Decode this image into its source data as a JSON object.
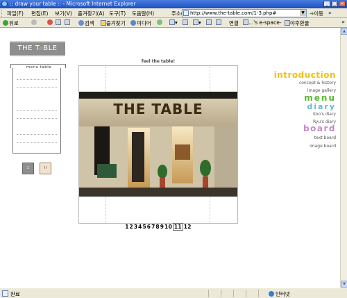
{
  "window": {
    "title": ":: draw your table :: - Microsoft Internet Explorer",
    "buttons": {
      "minimize": "_",
      "maximize": "□",
      "close": "×"
    }
  },
  "menubar": {
    "items": [
      "파일(F)",
      "편집(E)",
      "보기(V)",
      "즐겨찾기(A)",
      "도구(T)",
      "도움말(H)"
    ],
    "address_label": "주소(D)",
    "address_value": "http://www.the-table.com/1-3.php#",
    "go_label": "이동",
    "links_label": "»"
  },
  "toolbar": {
    "back": "뒤로",
    "forward": "→",
    "search": "검색",
    "favorites": "즐겨찾기",
    "media": "미디어",
    "links_label": "연결",
    "link1": "...'s e-space-",
    "link2": "야후환율",
    "more": "»"
  },
  "site": {
    "logo": {
      "pre": "THE T",
      "accent": "a",
      "post": "BLE"
    },
    "nav_header": "menu table",
    "nav": {
      "introduction": "introduction",
      "concept": "concept & history",
      "gallery": "image gallery",
      "menu": "menu",
      "diary": "diary",
      "koo": "Koo's diary",
      "ryu": "Ryu's diary",
      "board": "board",
      "text_board": "text board",
      "image_board": "image board"
    },
    "page_buttons": [
      "1",
      "II"
    ],
    "gallery_caption": "feel the table!",
    "photo_sign": "THE TABLE",
    "page_numbers": [
      "1",
      "2",
      "3",
      "4",
      "5",
      "6",
      "7",
      "8",
      "9",
      "10",
      "11",
      "12"
    ],
    "current_page": "11"
  },
  "statusbar": {
    "status": "완료",
    "zone": "인터넷"
  },
  "colors": {
    "intro": "#f0c20a",
    "menu": "#5ab82e",
    "diary": "#63b9d8",
    "board": "#c48ac8",
    "logo_bg": "#8e8e8e"
  }
}
